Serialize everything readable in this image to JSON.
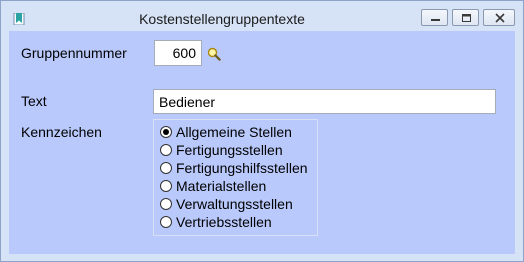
{
  "window": {
    "title": "Kostenstellengruppentexte",
    "app_icon": "bookmark-icon",
    "controls": {
      "minimize_icon": "minimize-icon",
      "maximize_icon": "maximize-icon",
      "close_icon": "close-icon"
    }
  },
  "form": {
    "gruppennummer_label": "Gruppennummer",
    "gruppennummer_value": "600",
    "lookup_icon": "magnifier-icon",
    "text_label": "Text",
    "text_value": "Bediener",
    "kennzeichen_label": "Kennzeichen",
    "kennzeichen_options": [
      {
        "label": "Allgemeine Stellen",
        "checked": true
      },
      {
        "label": "Fertigungsstellen",
        "checked": false
      },
      {
        "label": "Fertigungshilfsstellen",
        "checked": false
      },
      {
        "label": "Materialstellen",
        "checked": false
      },
      {
        "label": "Verwaltungsstellen",
        "checked": false
      },
      {
        "label": "Vertriebsstellen",
        "checked": false
      }
    ]
  },
  "colors": {
    "client_background": "#b9c9fc",
    "frame_background": "#d6e2f6",
    "icon_accent": "#2aa3a3"
  }
}
